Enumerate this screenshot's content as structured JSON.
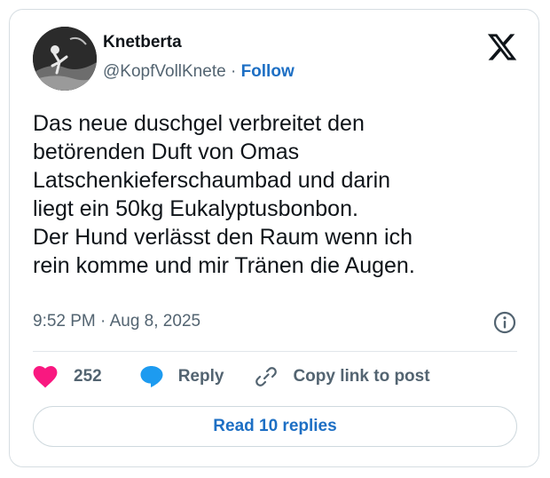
{
  "author": {
    "name": "Knetberta",
    "handle": "@KopfVollKnete",
    "separator": "·",
    "follow_label": "Follow"
  },
  "tweet": {
    "text": "Das neue duschgel verbreitet den\nbetörenden Duft von Omas\nLatschenkieferschaumbad und darin\nliegt ein 50kg Eukalyptusbonbon.\nDer Hund verlässt den Raum wenn ich\nrein komme und mir Tränen die Augen.",
    "timestamp": "9:52 PM · Aug 8, 2025"
  },
  "actions": {
    "like_count": "252",
    "reply_label": "Reply",
    "copy_label": "Copy link to post"
  },
  "read_replies_label": "Read 10 replies",
  "colors": {
    "accent": "#1d6fc4",
    "like": "#f91880",
    "reply_icon": "#1d9bf0",
    "text_primary": "#0f1419",
    "text_secondary": "#536471"
  },
  "icons": {
    "brand": "x-logo-icon",
    "info": "info-icon",
    "like": "heart-icon",
    "reply": "speech-bubble-icon",
    "copy": "link-icon"
  }
}
